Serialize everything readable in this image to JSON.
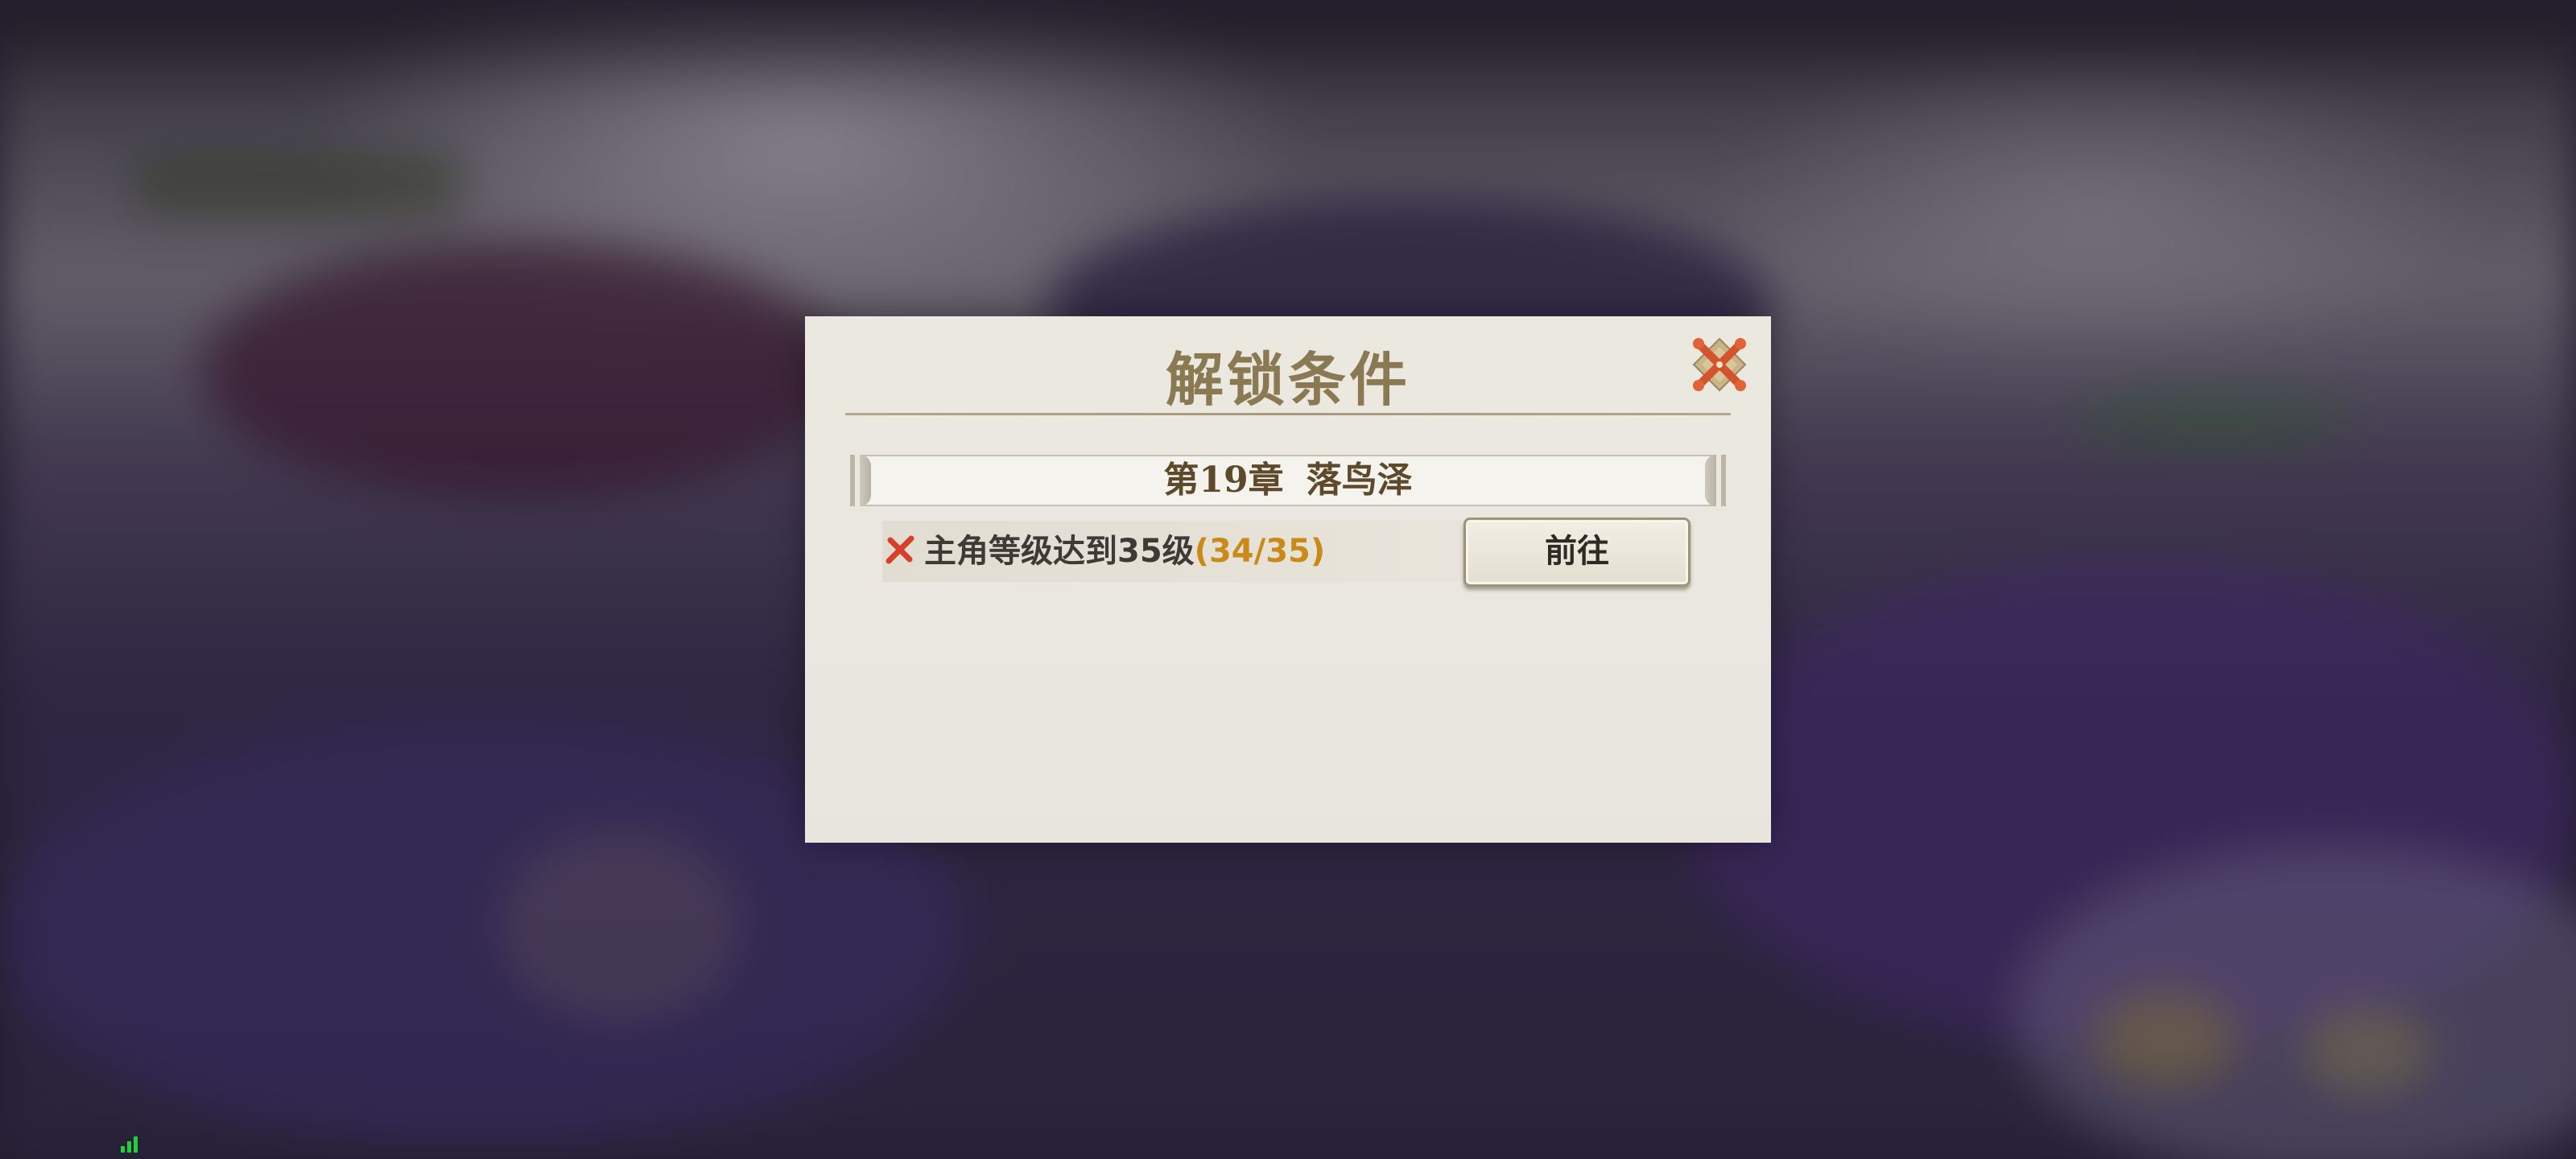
{
  "dialog": {
    "title": "解锁条件",
    "close_icon": "close-x-icon",
    "chapter": {
      "number_label": "第19章",
      "name": "落鸟泽"
    },
    "conditions": [
      {
        "status_icon": "cross-fail-icon",
        "text": "主角等级达到35级",
        "progress": "(34/35)",
        "action_label": "前往"
      }
    ]
  },
  "colors": {
    "title": "#8a7a53",
    "progress": "#c98a17",
    "fail_icon": "#d8402c",
    "signal": "#22d13a"
  },
  "status_bar": {
    "signal_icon": "signal-bars-icon"
  }
}
